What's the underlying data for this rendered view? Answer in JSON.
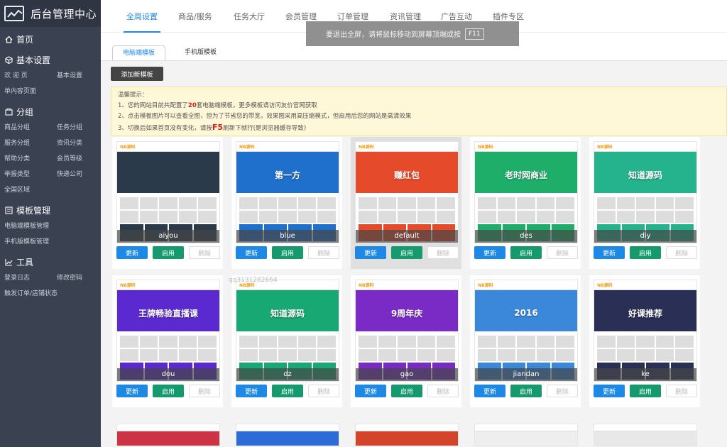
{
  "app": {
    "title": "后台管理中心"
  },
  "sidebar": {
    "home": "首页",
    "sections": [
      {
        "title": "基本设置",
        "items": [
          "欢 迎 页",
          "基本设置",
          "单内容页面"
        ]
      },
      {
        "title": "分组",
        "items": [
          "商品分组",
          "任务分组",
          "服务分组",
          "资讯分类",
          "帮助分类",
          "会员等级",
          "举报类型",
          "快递公司",
          "全国区域"
        ]
      },
      {
        "title": "模板管理",
        "items": [
          "电脑端模板管理",
          "手机版模板管理"
        ]
      },
      {
        "title": "工具",
        "items": [
          "登录日志",
          "修改密码",
          "触发订单/店铺状态"
        ]
      }
    ]
  },
  "top_tabs": [
    "全局设置",
    "商品/服务",
    "任务大厅",
    "会员管理",
    "订单管理",
    "资讯管理",
    "广告互动",
    "插件专区"
  ],
  "toast": {
    "text": "要退出全屏，请将鼠标移动到屏幕顶端或按",
    "key": "F11"
  },
  "sub_tabs": [
    "电脑端模板",
    "手机版模板"
  ],
  "add_button": "添加新模板",
  "notice": {
    "title": "温馨提示：",
    "line1_pre": "1、您的网站目前共配置了",
    "line1_count": "20",
    "line1_post": "套电脑端模板，更多模板请访问友价官网获取",
    "line2": "2、点击模板图片可以查看全图，但为了节省您的带宽，效果图采用高压缩模式，但启用后您的网站是高清效果",
    "line3_pre": "3、切换后如果首页没有变化，请按",
    "line3_key": "F5",
    "line3_post": "刷新下就行(是浏览器缓存导致)"
  },
  "card_buttons": {
    "update": "更新",
    "enable": "启用",
    "delete": "删除"
  },
  "watermark": "qq3131282664",
  "templates": [
    {
      "name": "aiyou",
      "banner": "",
      "color": "#2b3a4a"
    },
    {
      "name": "blue",
      "banner": "第一方",
      "color": "#1f6fcc"
    },
    {
      "name": "default",
      "banner": "赚红包",
      "color": "#e54b2a"
    },
    {
      "name": "des",
      "banner": "老时网商业",
      "color": "#1fae6a"
    },
    {
      "name": "diy",
      "banner": "知道源码",
      "color": "#24b38c"
    },
    {
      "name": "dou",
      "banner": "王牌畅验直播课",
      "color": "#5a2ad0"
    },
    {
      "name": "dz",
      "banner": "知道源码",
      "color": "#18a874"
    },
    {
      "name": "gao",
      "banner": "9周年庆",
      "color": "#7b2bc5"
    },
    {
      "name": "jiandan",
      "banner": "2016",
      "color": "#3b87d9"
    },
    {
      "name": "ke",
      "banner": "好课推荐",
      "color": "#2a2f55"
    }
  ],
  "partial_colors": [
    "#cc3344",
    "#2d6bd6",
    "#d4442a",
    "#eeeeee",
    "#e8e8e8",
    "#a02a2a"
  ]
}
